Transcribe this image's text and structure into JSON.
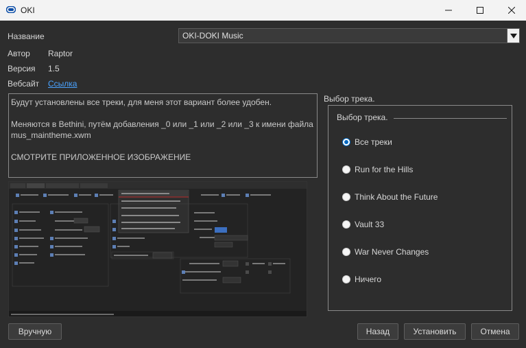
{
  "window": {
    "title": "OKI",
    "colors": {
      "titlebar": "#f3f3f3",
      "client": "#2d2d2d",
      "accent": "#0067c0",
      "link": "#4aa3ff"
    }
  },
  "fields": {
    "name_label": "Название",
    "name_value": "OKI-DOKI Music",
    "author_label": "Автор",
    "author_value": "Raptor",
    "version_label": "Версия",
    "version_value": "1.5",
    "website_label": "Вебсайт",
    "website_link": "Ссылка"
  },
  "description": {
    "line1": "Будут установлены все треки, для меня этот вариант более удобен.",
    "line2": "Меняются в Bethini, путём добавления  _0  или _1  или _2  или _3  к имени файла",
    "line3": "mus_maintheme.xwm",
    "line4": "СМОТРИТЕ ПРИЛОЖЕННОЕ ИЗОБРАЖЕНИЕ"
  },
  "track_group": {
    "outer_title": "Выбор трека.",
    "inner_title": "Выбор трека.",
    "options": [
      {
        "label": "Все треки",
        "selected": true
      },
      {
        "label": "Run for the Hills",
        "selected": false
      },
      {
        "label": "Think About the Future",
        "selected": false
      },
      {
        "label": "Vault 33",
        "selected": false
      },
      {
        "label": "War Never Changes",
        "selected": false
      },
      {
        "label": "Ничего",
        "selected": false
      }
    ]
  },
  "buttons": {
    "manual": "Вручную",
    "back": "Назад",
    "install": "Установить",
    "cancel": "Отмена"
  }
}
